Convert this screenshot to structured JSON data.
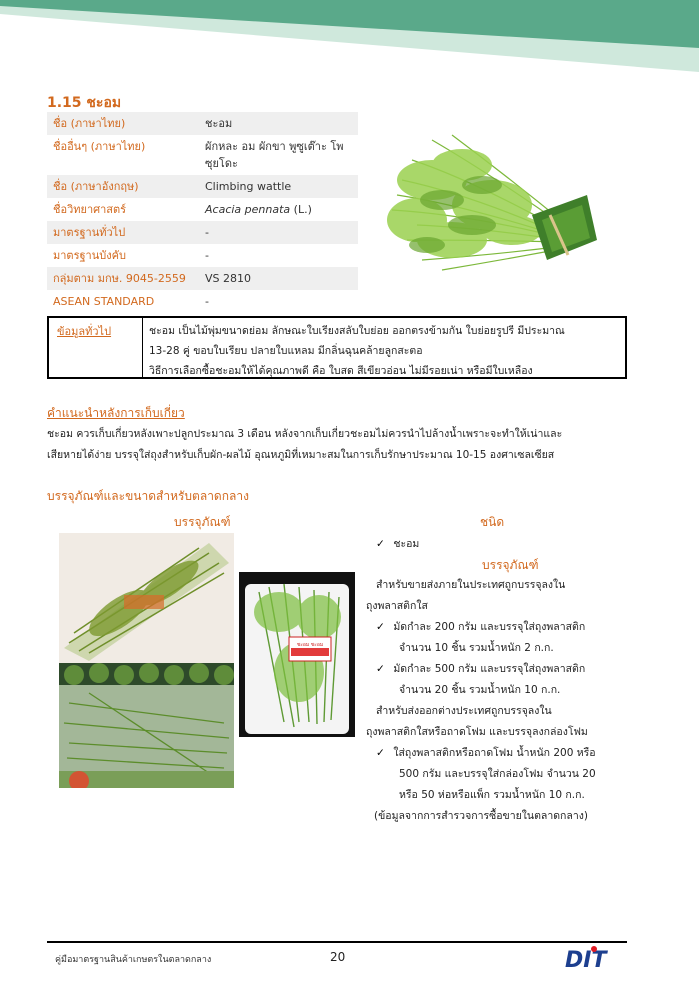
{
  "section": {
    "title": "1.15 ชะอม"
  },
  "info_rows": [
    {
      "key": "ชื่อ (ภาษาไทย)",
      "value": "ชะอม",
      "italic": false
    },
    {
      "key": "ชื่ออื่นๆ (ภาษาไทย)",
      "value": "ผักหละ อม ผักขา พูซูเต๊าะ โพซุยโดะ",
      "italic": false
    },
    {
      "key": "ชื่อ (ภาษาอังกฤษ)",
      "value": "Climbing wattle",
      "italic": false
    },
    {
      "key": "ชื่อวิทยาศาสตร์",
      "value": "Acacia pennata",
      "value_suffix": " (L.)",
      "italic": true
    },
    {
      "key": "มาตรฐานทั่วไป",
      "value": "-",
      "italic": false
    },
    {
      "key": "มาตรฐานบังคับ",
      "value": "-",
      "italic": false
    },
    {
      "key": "กลุ่มตาม มกษ. 9045-2559",
      "value": "VS 2810",
      "italic": false
    },
    {
      "key": "ASEAN STANDARD",
      "value": "-",
      "italic": false
    }
  ],
  "general": {
    "label": "ข้อมูลทั่วไป",
    "line1": "ชะอม เป็นไม้พุ่มขนาดย่อม ลักษณะใบเรียงสลับใบย่อย ออกตรงข้ามกัน ใบย่อยรูปรี มีประมาณ",
    "line2": "13-28 คู่ ขอบใบเรียบ ปลายใบแหลม มีกลิ่นฉุนคล้ายลูกสะตอ",
    "line3": "วิธีการเลือกซื้อชะอมให้ได้คุณภาพดี คือ ใบสด สีเขียวอ่อน ไม่มีรอยเน่า หรือมีใบเหลือง"
  },
  "harvest": {
    "title": "คำแนะนำหลังการเก็บเกี่ยว",
    "line1": "ชะอม ควรเก็บเกี่ยวหลังเพาะปลูกประมาณ 3 เดือน หลังจากเก็บเกี่ยวชะอมไม่ควรนำไปล้างน้ำเพราะจะทำให้เน่าและ",
    "line2": "เสียหายได้ง่าย บรรจุใส่ถุงสำหรับเก็บผัก-ผลไม้ อุณหภูมิที่เหมาะสมในการเก็บรักษาประมาณ 10-15 องศาเซลเซียส"
  },
  "packaging": {
    "title": "บรรจุภัณฑ์และขนาดสำหรับตลาดกลาง",
    "col_package": "บรรจุภัณฑ์",
    "col_type": "ชนิด",
    "type_item": "ชะอม",
    "pkg_heading": "บรรจุภัณฑ์",
    "domestic_1": "สำหรับขายส่งภายในประเทศถูกบรรจุลงใน",
    "domestic_2": "ถุงพลาสติกใส",
    "item1_1": "มัดกำละ 200 กรัม และบรรจุใส่ถุงพลาสติก",
    "item1_2": "จำนวน 10 ชิ้น รวมน้ำหนัก 2 ก.ก.",
    "item2_1": "มัดกำละ 500 กรัม และบรรจุใส่ถุงพลาสติก",
    "item2_2": "จำนวน 20 ชิ้น รวมน้ำหนัก 10 ก.ก.",
    "export_1": "สำหรับส่งออกต่างประเทศถูกบรรจุลงใน",
    "export_2": "ถุงพลาสติกใสหรือถาดโฟม และบรรจุลงกล่องโฟม",
    "item3_1": "ใส่ถุงพลาสติกหรือถาดโฟม น้ำหนัก 200 หรือ",
    "item3_2": "500 กรัม และบรรจุใส่กล่องโฟม จำนวน 20",
    "item3_3": "หรือ 50 ห่อหรือแพ็ก รวมน้ำหนัก 10 ก.ก.",
    "source": "(ข้อมูลจากการสำรวจการซื้อขายในตลาดกลาง)",
    "tray_label": "ชะอม ชะอม"
  },
  "footer": {
    "text": "คู่มือมาตรฐานสินค้าเกษตรในตลาดกลาง",
    "page": "20",
    "logo_text": "DIT"
  },
  "colors": {
    "accent": "#d2691e",
    "header_green": "#5aa98a",
    "header_light": "#cfe8dc",
    "logo_blue": "#1d3f8f",
    "logo_red": "#e01b24"
  }
}
